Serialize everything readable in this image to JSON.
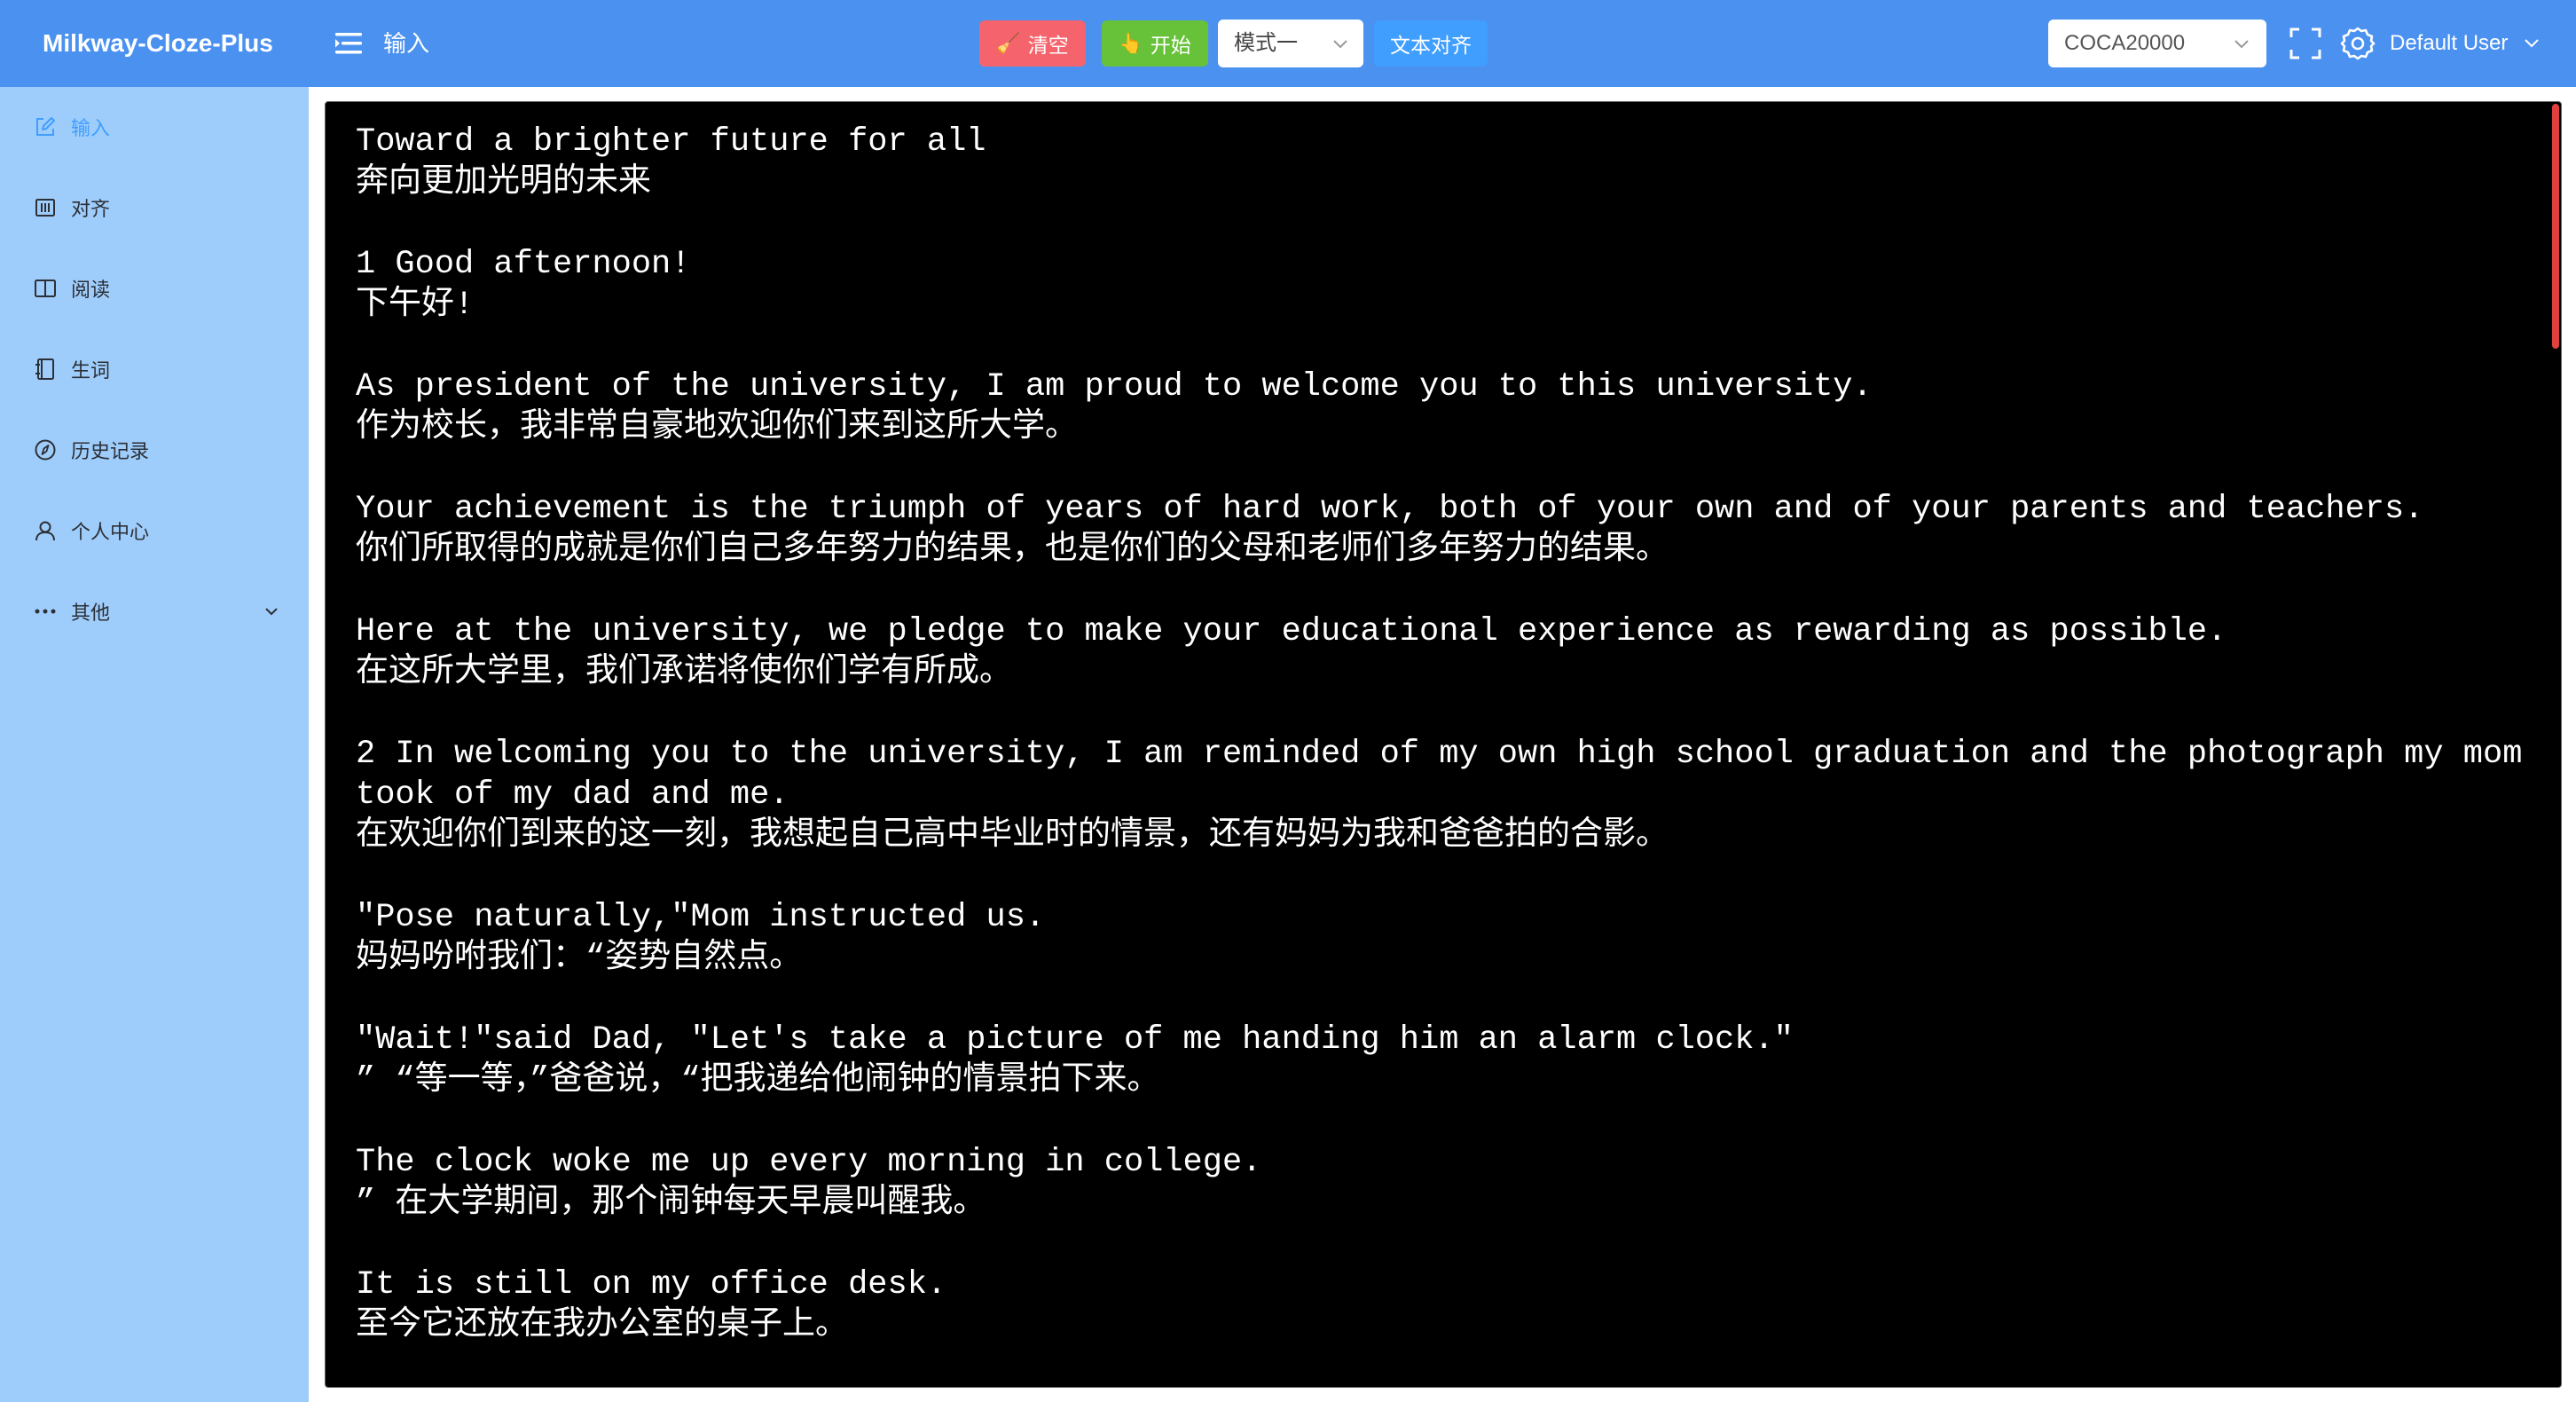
{
  "app": {
    "title": "Milkway-Cloze-Plus",
    "page_title": "输入"
  },
  "toolbar": {
    "clear_label": "清空",
    "start_label": "开始",
    "mode_value": "模式一",
    "align_label": "文本对齐",
    "dictionary_value": "COCA20000",
    "user_name": "Default User"
  },
  "sidebar": {
    "items": [
      {
        "label": "输入",
        "icon": "edit-icon",
        "active": true
      },
      {
        "label": "对齐",
        "icon": "align-icon"
      },
      {
        "label": "阅读",
        "icon": "book-open-icon"
      },
      {
        "label": "生词",
        "icon": "notebook-icon"
      },
      {
        "label": "历史记录",
        "icon": "history-icon"
      },
      {
        "label": "个人中心",
        "icon": "user-icon"
      },
      {
        "label": "其他",
        "icon": "more-icon",
        "expandable": true
      }
    ]
  },
  "editor": {
    "content": "Toward a brighter future for all\n奔向更加光明的未来\n\n1 Good afternoon!\n下午好!\n\nAs president of the university, I am proud to welcome you to this university.\n作为校长，我非常自豪地欢迎你们来到这所大学。\n\nYour achievement is the triumph of years of hard work, both of your own and of your parents and teachers.\n你们所取得的成就是你们自己多年努力的结果，也是你们的父母和老师们多年努力的结果。\n\nHere at the university, we pledge to make your educational experience as rewarding as possible.\n在这所大学里，我们承诺将使你们学有所成。\n\n2 In welcoming you to the university, I am reminded of my own high school graduation and the photograph my mom took of my dad and me.\n在欢迎你们到来的这一刻，我想起自己高中毕业时的情景，还有妈妈为我和爸爸拍的合影。\n\n\"Pose naturally,\"Mom instructed us.\n妈妈吩咐我们：“姿势自然点。\n\n\"Wait!\"said Dad, \"Let's take a picture of me handing him an alarm clock.\"\n” “等一等，”爸爸说，“把我递给他闹钟的情景拍下来。\n\nThe clock woke me up every morning in college.\n” 在大学期间，那个闹钟每天早晨叫醒我。\n\nIt is still on my office desk.\n至今它还放在我办公室的桌子上。",
    "scroll_position": 0
  },
  "colors": {
    "header": "#4b91ef",
    "sidebar": "#9fcdfb",
    "active": "#409eff",
    "clear_button": "#f5646c",
    "start_button": "#67c23a",
    "align_button": "#409eff",
    "editor_bg": "#000000",
    "scroll_thumb": "#e0413e"
  }
}
